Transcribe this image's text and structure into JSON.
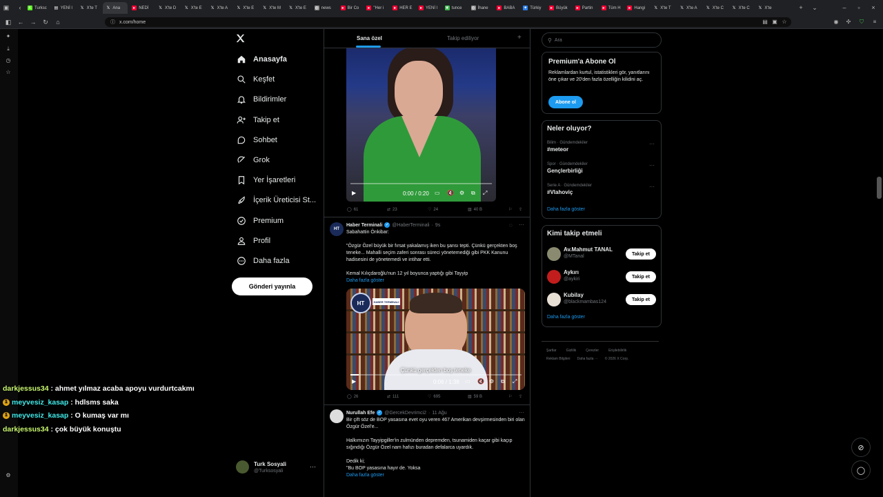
{
  "browser": {
    "tabs": [
      {
        "label": "Turksc",
        "icon": "kick-icon"
      },
      {
        "label": "YENİ l",
        "icon": "page-icon"
      },
      {
        "label": "X'te T",
        "icon": "x-icon"
      },
      {
        "label": "Ana",
        "icon": "x-icon"
      },
      {
        "label": "NEDİ",
        "icon": "youtube-icon"
      },
      {
        "label": "X'te D",
        "icon": "x-icon"
      },
      {
        "label": "X'te E",
        "icon": "x-icon"
      },
      {
        "label": "X'te A",
        "icon": "x-icon"
      },
      {
        "label": "X'te E",
        "icon": "x-icon"
      },
      {
        "label": "X'te M",
        "icon": "x-icon"
      },
      {
        "label": "X'te E",
        "icon": "x-icon"
      },
      {
        "label": "news",
        "icon": "globe-icon"
      },
      {
        "label": "Bir Co",
        "icon": "youtube-icon"
      },
      {
        "label": "\"Her i",
        "icon": "youtube-icon"
      },
      {
        "label": "HER E",
        "icon": "youtube-icon"
      },
      {
        "label": "YENİ l",
        "icon": "youtube-icon"
      },
      {
        "label": "tunce",
        "icon": "leaf-icon"
      },
      {
        "label": "İhane",
        "icon": "globe-icon"
      },
      {
        "label": "BABA",
        "icon": "youtube-icon"
      },
      {
        "label": "Türkiy",
        "icon": "star-icon"
      },
      {
        "label": "Büyük",
        "icon": "youtube-icon"
      },
      {
        "label": "Partin",
        "icon": "youtube-icon"
      },
      {
        "label": "Tüm H",
        "icon": "youtube-icon"
      },
      {
        "label": "Hangi",
        "icon": "youtube-icon"
      },
      {
        "label": "X'te T",
        "icon": "x-icon"
      },
      {
        "label": "X'te A",
        "icon": "x-icon"
      },
      {
        "label": "X'te C",
        "icon": "x-icon"
      },
      {
        "label": "X'te C",
        "icon": "x-icon"
      },
      {
        "label": "X'te",
        "icon": "x-icon"
      }
    ],
    "url": "x.com/home"
  },
  "nav": {
    "items": [
      {
        "label": "Anasayfa",
        "icon": "home-icon",
        "active": true
      },
      {
        "label": "Keşfet",
        "icon": "search-icon"
      },
      {
        "label": "Bildirimler",
        "icon": "bell-icon"
      },
      {
        "label": "Takip et",
        "icon": "follow-icon"
      },
      {
        "label": "Sohbet",
        "icon": "chat-icon"
      },
      {
        "label": "Grok",
        "icon": "grok-icon"
      },
      {
        "label": "Yer İşaretleri",
        "icon": "bookmark-icon"
      },
      {
        "label": "İçerik Üreticisi St...",
        "icon": "rocket-icon"
      },
      {
        "label": "Premium",
        "icon": "premium-icon"
      },
      {
        "label": "Profil",
        "icon": "profile-icon"
      },
      {
        "label": "Daha fazla",
        "icon": "more-circle-icon"
      }
    ],
    "post_button": "Gönderi yayınla",
    "account": {
      "name": "Turk Sosyali",
      "handle": "@Turksosyali"
    }
  },
  "feed": {
    "tabs": [
      "Sana özel",
      "Takip ediliyor"
    ],
    "tweets": [
      {
        "video_time": "0:00 / 0:20",
        "stats": {
          "replies": "61",
          "reposts": "23",
          "likes": "24",
          "views": "40 B"
        }
      },
      {
        "name": "Haber Terminali",
        "handle": "@HaberTerminali",
        "time": "9s",
        "text": "Sabahattin Önkibar:\n\n\"Özgür Özel büyük bir fırsat yakalamış iken bu şansı tepti. Çünkü gerçekten boş teneke... Mahalli seçim zaferi sonrası süreci yönetemediği gibi PKK Kanunu hadisesini de yönetemedi ve intihar etti.\n\nKemal Kılıçdaroğlu'nun 12 yıl boyunca yaptığı gibi Tayyip",
        "show_more": "Daha fazla göster",
        "video_time": "0:06 / 1:38",
        "subtitle": "Çünkü gerçekten boş teneke",
        "overlay_text": "HABER TERMİNALİ",
        "stats": {
          "replies": "26",
          "reposts": "111",
          "likes": "695",
          "views": "59 B"
        }
      },
      {
        "name": "Nurullah Efe",
        "handle": "@GercekDevrimci2",
        "time": "11 Ağu",
        "text": "Bir çift söz de BOP yasasına evet oyu veren 467 Amerikan devşirmesinden biri olan Özgür Özel'e...\n\nHalkımızın Tayyipgiller'in zulmünden depremden, tsunamiden kaçar gibi kaçıp sığındığı Özgür Özel nam hafızı buradan defalarca uyardık.\n\nDedik ki;\n\"Bu BOP yasasına hayır de. Yoksa",
        "show_more": "Daha fazla göster"
      }
    ]
  },
  "right": {
    "search_placeholder": "Ara",
    "premium": {
      "title": "Premium'a Abone Ol",
      "text": "Reklamlardan kurtul, istatistikleri gör, yanıtlarını öne çıkar ve 20'den fazla özelliğin kilidini aç.",
      "button": "Abone ol"
    },
    "trends": {
      "title": "Neler oluyor?",
      "items": [
        {
          "context": "Bilim · Gündemdekiler",
          "tag": "#meteor"
        },
        {
          "context": "Spor · Gündemdekiler",
          "tag": "Gençlerbirliği"
        },
        {
          "context": "Serie A · Gündemdekiler",
          "tag": "#Vlahoviç"
        }
      ],
      "more": "Daha fazla göster"
    },
    "who_to_follow": {
      "title": "Kimi takip etmeli",
      "items": [
        {
          "name": "Av.Mahmut TANAL",
          "handle": "@MTanal",
          "button": "Takip et"
        },
        {
          "name": "Aykırı",
          "handle": "@aykiri",
          "button": "Takip et"
        },
        {
          "name": "Kubilay",
          "handle": "@blackmambas124",
          "button": "Takip et"
        }
      ],
      "more": "Daha fazla göster"
    },
    "footer": {
      "line1": [
        "Şartlar",
        "Gizlilik",
        "Çerezler",
        "Erişilebilirlik"
      ],
      "line2": [
        "Reklam Bilgileri",
        "Daha fazla ···",
        "© 2026 X Corp."
      ]
    }
  },
  "chat": [
    {
      "user": "darkjessus34",
      "msg": " : ahmet yılmaz acaba apoyu vurdurtcakmı",
      "color": "#c9f76f",
      "badge": ""
    },
    {
      "user": "meyvesiz_kasap",
      "msg": " : hdlsms saka",
      "color": "#41e8e8",
      "badge": "1"
    },
    {
      "user": "meyvesiz_kasap",
      "msg": " : O kumaş var mı",
      "color": "#41e8e8",
      "badge": "1"
    },
    {
      "user": "darkjessus34",
      "msg": " : çok büyük konuştu",
      "color": "#c9f76f",
      "badge": ""
    }
  ],
  "colors": {
    "accent": "#1d9bf0",
    "background": "#000000",
    "border": "#2f3336"
  }
}
